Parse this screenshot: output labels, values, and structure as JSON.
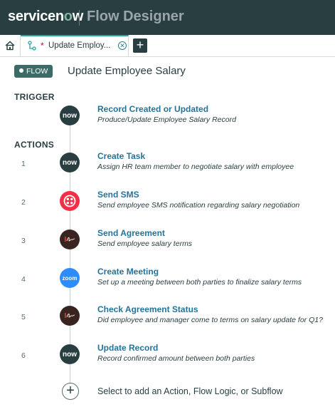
{
  "header": {
    "brand_pre": "servicen",
    "brand_o": "o",
    "brand_post": "w",
    "app_title": "Flow Designer"
  },
  "tabs": {
    "active_label": "Update Employ...",
    "dirty_marker": "*",
    "add_label": "+"
  },
  "flow": {
    "badge": "FLOW",
    "title": "Update Employee Salary"
  },
  "sections": {
    "trigger": "TRIGGER",
    "actions": "ACTIONS"
  },
  "trigger": {
    "icon": "now",
    "title": "Record Created or Updated",
    "desc": "Produce/Update Employee Salary Record"
  },
  "actions": [
    {
      "num": "1",
      "icon": "now",
      "title": "Create Task",
      "desc": "Assign HR team member to negotiate salary with employee"
    },
    {
      "num": "2",
      "icon": "twilio",
      "title": "Send SMS",
      "desc": "Send employee SMS notification regarding salary negotiation"
    },
    {
      "num": "3",
      "icon": "docusign",
      "title": "Send Agreement",
      "desc": "Send employee salary terms"
    },
    {
      "num": "4",
      "icon": "zoom",
      "title": "Create Meeting",
      "desc": "Set up a meeting between both parties to finalize salary terms"
    },
    {
      "num": "5",
      "icon": "docusign",
      "title": "Check Agreement Status",
      "desc": "Did employee and manager come to terms on salary update for Q1?"
    },
    {
      "num": "6",
      "icon": "now",
      "title": "Update Record",
      "desc": "Record confirmed amount between both parties"
    }
  ],
  "add_step": {
    "label": "Select to add an Action, Flow Logic, or Subflow"
  },
  "colors": {
    "header_bg": "#293e41",
    "accent_link": "#23739a",
    "badge_bg": "#3b6b66",
    "twilio": "#f22f46",
    "zoom": "#2d8cff"
  }
}
